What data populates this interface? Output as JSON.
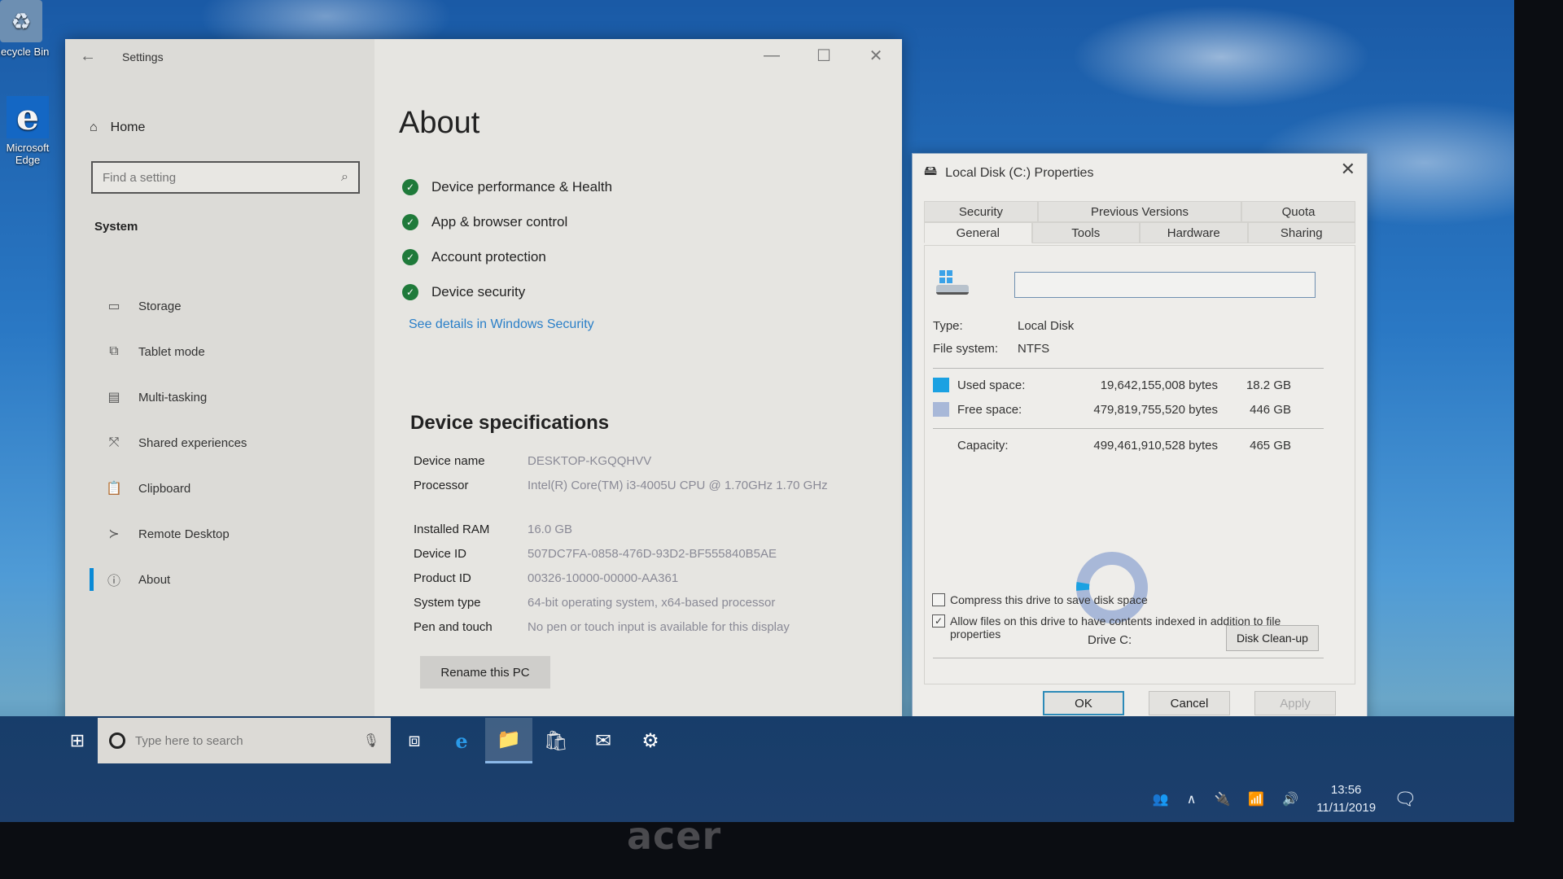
{
  "desktop": {
    "icons": [
      {
        "label": "Recycle Bin",
        "icon": "recycle-bin-icon"
      },
      {
        "label": "Microsoft Edge",
        "icon": "edge-icon"
      }
    ]
  },
  "settings": {
    "title": "Settings",
    "back_icon": "←",
    "controls": {
      "minimize": "—",
      "maximize": "☐",
      "close": "✕"
    },
    "home_label": "Home",
    "search_placeholder": "Find a setting",
    "section": "System",
    "nav": [
      {
        "label": "Storage",
        "icon": "▭",
        "active": false
      },
      {
        "label": "Tablet mode",
        "icon": "⧉",
        "active": false
      },
      {
        "label": "Multi-tasking",
        "icon": "▤",
        "active": false
      },
      {
        "label": "Shared experiences",
        "icon": "⤧",
        "active": false
      },
      {
        "label": "Clipboard",
        "icon": "📋",
        "active": false
      },
      {
        "label": "Remote Desktop",
        "icon": "≻",
        "active": false
      },
      {
        "label": "About",
        "icon": "ⓘ",
        "active": true
      }
    ],
    "page_title": "About",
    "health": [
      "Device performance & Health",
      "App & browser control",
      "Account protection",
      "Device security"
    ],
    "security_link": "See details in Windows Security",
    "specs_title": "Device specifications",
    "specs": [
      {
        "label": "Device name",
        "value": "DESKTOP-KGQQHVV"
      },
      {
        "label": "Processor",
        "value": "Intel(R) Core(TM) i3-4005U CPU @ 1.70GHz   1.70 GHz"
      },
      {
        "label": "Installed RAM",
        "value": "16.0 GB"
      },
      {
        "label": "Device ID",
        "value": "507DC7FA-0858-476D-93D2-BF555840B5AE"
      },
      {
        "label": "Product ID",
        "value": "00326-10000-00000-AA361"
      },
      {
        "label": "System type",
        "value": "64-bit operating system, x64-based processor"
      },
      {
        "label": "Pen and touch",
        "value": "No pen or touch input is available for this display"
      }
    ],
    "rename_button": "Rename this PC"
  },
  "properties": {
    "title": "Local Disk (C:) Properties",
    "close": "✕",
    "tabs_row1": [
      "Security",
      "Previous Versions",
      "Quota"
    ],
    "tabs_row2": [
      "General",
      "Tools",
      "Hardware",
      "Sharing"
    ],
    "active_tab": "General",
    "label_value": "",
    "type_label": "Type:",
    "type_value": "Local Disk",
    "fs_label": "File system:",
    "fs_value": "NTFS",
    "used": {
      "label": "Used space:",
      "bytes": "19,642,155,008 bytes",
      "size": "18.2 GB",
      "color": "#1ba1e2"
    },
    "free": {
      "label": "Free space:",
      "bytes": "479,819,755,520 bytes",
      "size": "446 GB",
      "color": "#a8b8d8"
    },
    "capacity": {
      "label": "Capacity:",
      "bytes": "499,461,910,528 bytes",
      "size": "465 GB"
    },
    "used_fraction": 0.0393,
    "drive_label": "Drive C:",
    "cleanup_button": "Disk Clean-up",
    "compress": {
      "label": "Compress this drive to save disk space",
      "checked": false
    },
    "index": {
      "label": "Allow files on this drive to have contents indexed in addition to file properties",
      "checked": true
    },
    "buttons": {
      "ok": "OK",
      "cancel": "Cancel",
      "apply": "Apply"
    }
  },
  "taskbar": {
    "start_icon": "⊞",
    "search_placeholder": "Type here to search",
    "mic_icon": "🎙",
    "apps": [
      {
        "name": "task-view",
        "glyph": "⧈",
        "active": false
      },
      {
        "name": "edge",
        "glyph": "e",
        "active": false
      },
      {
        "name": "file-explorer",
        "glyph": "📁",
        "active": true
      },
      {
        "name": "store",
        "glyph": "🛍",
        "active": false
      },
      {
        "name": "mail",
        "glyph": "✉",
        "active": false
      },
      {
        "name": "settings",
        "glyph": "⚙",
        "active": false
      }
    ],
    "tray": {
      "people": "👥",
      "chevron": "∧",
      "battery": "🔌",
      "wifi": "📶",
      "volume": "🔊",
      "time": "13:56",
      "date": "11/11/2019",
      "notifications": "🗨"
    }
  },
  "bezel_brand": "acer"
}
